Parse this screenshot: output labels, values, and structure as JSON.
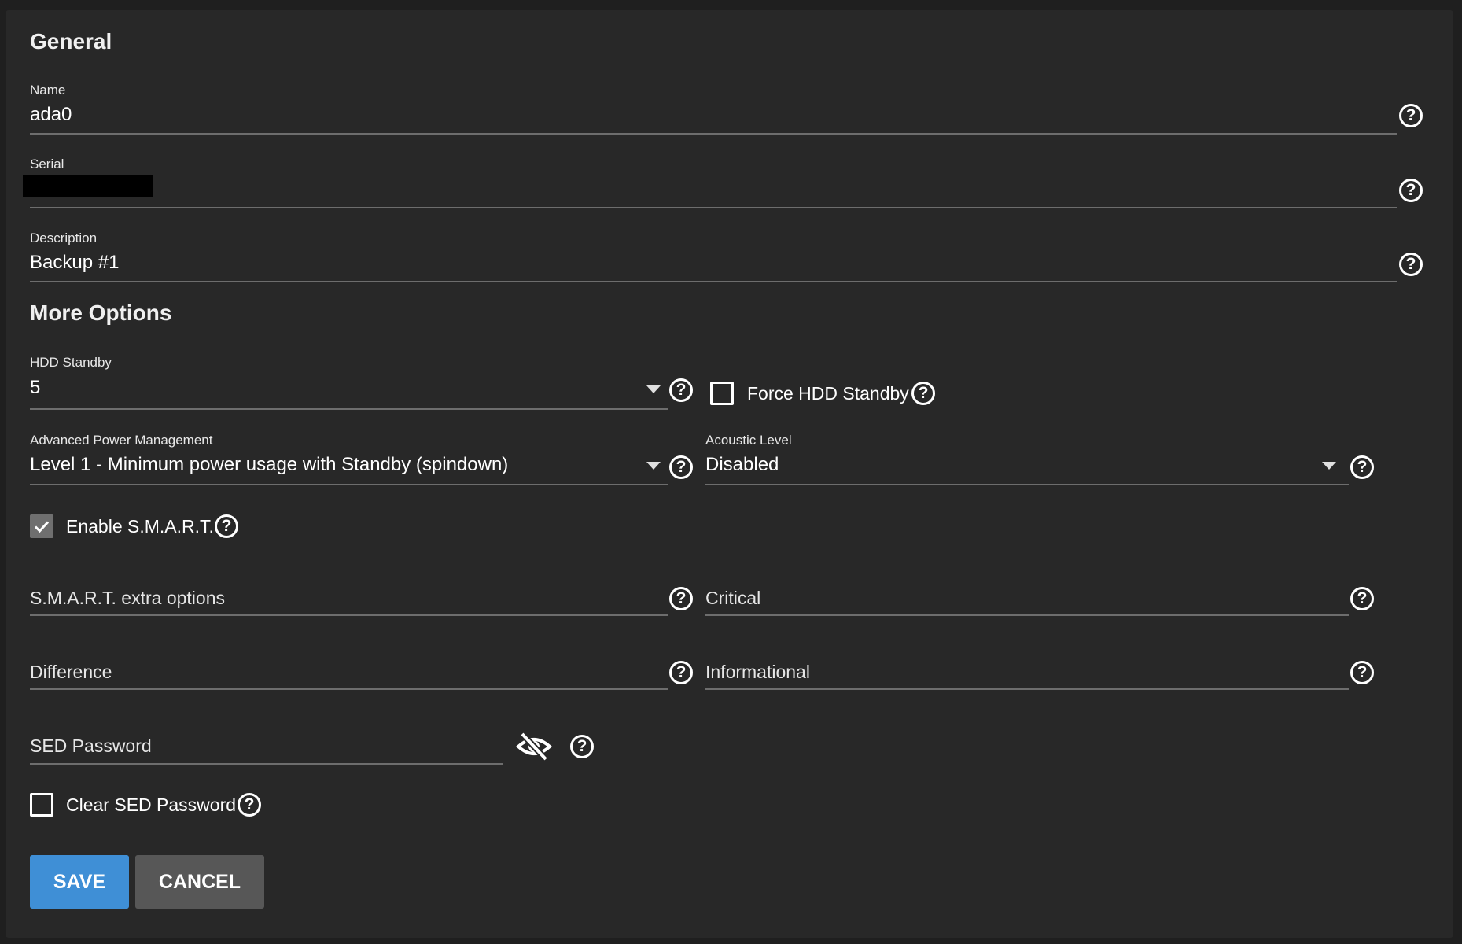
{
  "general": {
    "title": "General",
    "name": {
      "label": "Name",
      "value": "ada0"
    },
    "serial": {
      "label": "Serial",
      "value": ""
    },
    "description": {
      "label": "Description",
      "value": "Backup #1"
    }
  },
  "more_options": {
    "title": "More Options",
    "hdd_standby": {
      "label": "HDD Standby",
      "value": "5"
    },
    "force_hdd_standby": {
      "label": "Force HDD Standby",
      "checked": false
    },
    "apm": {
      "label": "Advanced Power Management",
      "value": "Level 1 - Minimum power usage with Standby (spindown)"
    },
    "acoustic": {
      "label": "Acoustic Level",
      "value": "Disabled"
    },
    "enable_smart": {
      "label": "Enable S.M.A.R.T.",
      "checked": true
    },
    "smart_extra": {
      "placeholder": "S.M.A.R.T. extra options"
    },
    "critical": {
      "placeholder": "Critical"
    },
    "difference": {
      "placeholder": "Difference"
    },
    "informational": {
      "placeholder": "Informational"
    },
    "sed_password": {
      "placeholder": "SED Password"
    },
    "clear_sed": {
      "label": "Clear SED Password",
      "checked": false
    }
  },
  "actions": {
    "save": "SAVE",
    "cancel": "CANCEL"
  },
  "icons": {
    "help": "help-circle-icon",
    "visibility": "eye-off-icon",
    "dropdown": "caret-down-icon",
    "check": "check-icon"
  },
  "colors": {
    "primary": "#3f8fd6",
    "secondary": "#575757",
    "surface": "#282828"
  }
}
